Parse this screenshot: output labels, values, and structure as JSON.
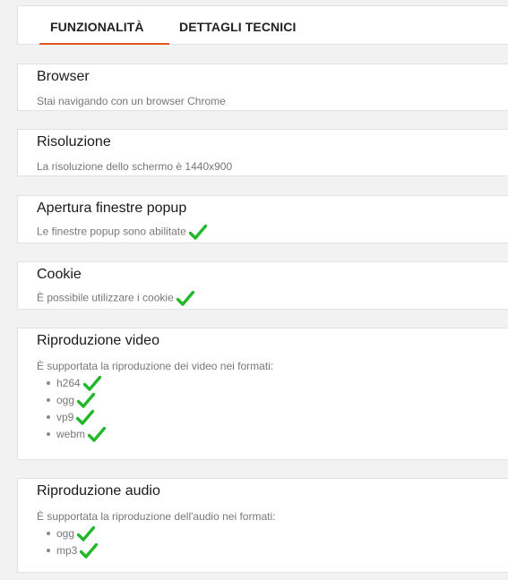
{
  "tabs": [
    {
      "label": "FUNZIONALITÀ",
      "active": true
    },
    {
      "label": "DETTAGLI TECNICI",
      "active": false
    }
  ],
  "accent_color": "#e1571f",
  "check_color": "#22b82a",
  "sections": {
    "browser": {
      "title": "Browser",
      "desc": "Stai navigando con un browser Chrome"
    },
    "resolution": {
      "title": "Risoluzione",
      "desc": "La risoluzione dello schermo è 1440x900"
    },
    "popup": {
      "title": "Apertura finestre popup",
      "desc": "Le finestre popup sono abilitate",
      "status": "check-icon"
    },
    "cookie": {
      "title": "Cookie",
      "desc": "È possibile utilizzare i cookie",
      "status": "check-icon"
    },
    "video": {
      "title": "Riproduzione video",
      "desc": "È supportata la riproduzione dei video nei formati:",
      "formats": [
        "h264",
        "ogg",
        "vp9",
        "webm"
      ]
    },
    "audio": {
      "title": "Riproduzione audio",
      "desc": "È supportata la riproduzione dell'audio nei formati:",
      "formats": [
        "ogg",
        "mp3"
      ]
    }
  }
}
